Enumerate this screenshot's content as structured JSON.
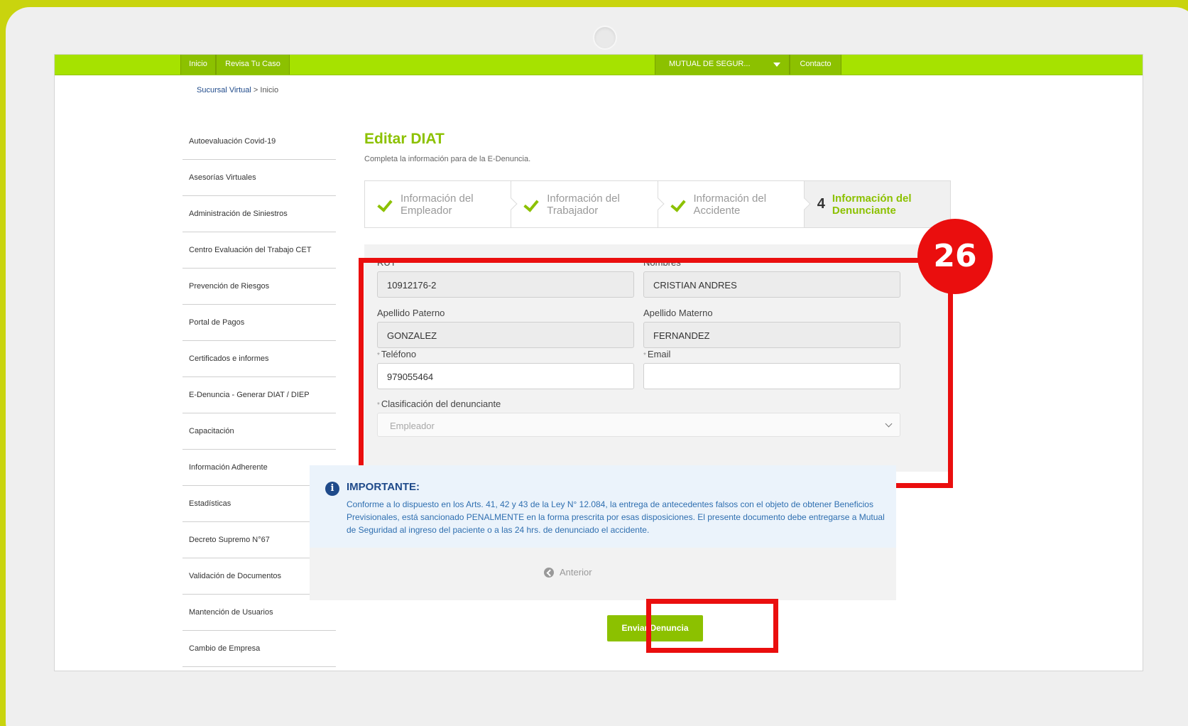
{
  "colors": {
    "brand_green": "#8cc100",
    "nav_green": "#a6e200",
    "highlight_red": "#ea0e0e",
    "info_blue": "#1f4a8a",
    "background_yellow": "#c9d40e"
  },
  "topnav": {
    "items": [
      "Inicio",
      "Revisa Tu Caso"
    ],
    "company_select": "MUTUAL DE SEGUR...",
    "contact": "Contacto"
  },
  "breadcrumb": {
    "link": "Sucursal Virtual",
    "current": "> Inicio"
  },
  "sidebar": {
    "items": [
      "Autoevaluación Covid-19",
      "Asesorías Virtuales",
      "Administración de Siniestros",
      "Centro Evaluación del Trabajo CET",
      "Prevención de Riesgos",
      "Portal de Pagos",
      "Certificados e informes",
      "E-Denuncia - Generar DIAT / DIEP",
      "Capacitación",
      "Información Adherente",
      "Estadísticas",
      "Decreto Supremo N°67",
      "Validación de Documentos",
      "Mantención de Usuarios",
      "Cambio de Empresa"
    ]
  },
  "main": {
    "title": "Editar DIAT",
    "subtitle": "Completa la información para de la E-Denuncia.",
    "steps": [
      {
        "label": "Información del Empleador",
        "icon": "check-icon"
      },
      {
        "label": "Información del Trabajador",
        "icon": "check-icon"
      },
      {
        "label": "Información del Accidente",
        "icon": "check-icon"
      },
      {
        "number": "4",
        "label": "Información del Denunciante"
      }
    ]
  },
  "form": {
    "rut_label": "RUT",
    "rut_value": "10912176-2",
    "nombres_label": "Nombres",
    "nombres_value": "CRISTIAN ANDRES",
    "apellido_paterno_label": "Apellido Paterno",
    "apellido_paterno_value": "GONZALEZ",
    "apellido_materno_label": "Apellido Materno",
    "apellido_materno_value": "FERNANDEZ",
    "required_mark": "*",
    "telefono_label": "Teléfono",
    "telefono_value": "979055464",
    "email_label": "Email",
    "email_value": "",
    "clasificacion_label": "Clasificación del denunciante",
    "clasificacion_value": "Empleador"
  },
  "annotation": {
    "badge": "26"
  },
  "important": {
    "icon": "i",
    "title": "IMPORTANTE:",
    "text": "Conforme a lo dispuesto en los Arts. 41, 42 y 43 de la Ley N° 12.084, la entrega de antecedentes falsos con el objeto de obtener Beneficios Previsionales, está sancionado PENALMENTE en la forma prescrita por esas disposiciones. El presente documento debe entregarse a Mutual de Seguridad al ingreso del paciente o a las 24 hrs. de denunciado el accidente."
  },
  "actions": {
    "prev_label": "Anterior",
    "submit_label": "Enviar Denuncia"
  }
}
